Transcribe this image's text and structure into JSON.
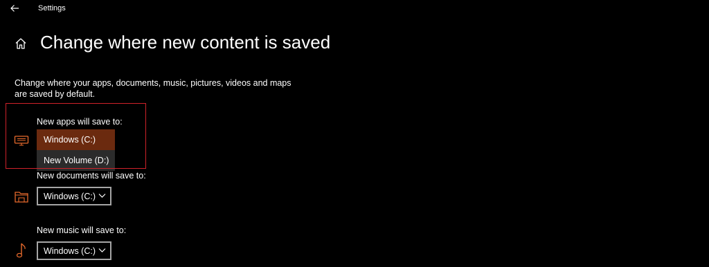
{
  "window": {
    "title": "Settings"
  },
  "page": {
    "title": "Change where new content is saved",
    "description": "Change where your apps, documents, music, pictures, videos and maps are saved by default."
  },
  "sections": {
    "apps": {
      "label": "New apps will save to:",
      "icon": "monitor-icon",
      "selected": "Windows (C:)",
      "options": [
        "Windows (C:)",
        "New Volume (D:)"
      ],
      "expanded": true
    },
    "documents": {
      "label": "New documents will save to:",
      "icon": "folder-icon",
      "selected": "Windows (C:)"
    },
    "music": {
      "label": "New music will save to:",
      "icon": "music-note-icon",
      "selected": "Windows (C:)"
    }
  },
  "colors": {
    "accent": "#e86a2c",
    "selected_option": "#6b2a0f",
    "highlight_border": "#d0222a",
    "dropdown_border": "#a6a6a6"
  }
}
